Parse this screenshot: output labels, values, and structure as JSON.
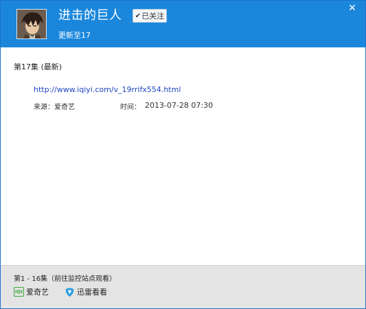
{
  "header": {
    "title": "进击的巨人",
    "follow_label": "已关注",
    "subtitle": "更新至17",
    "close_label": "✕"
  },
  "latest_episode": {
    "title": "第17集 (最新)",
    "url": "http://www.iqiyi.com/v_19rrifx554.html",
    "source_label": "来源：爱奇艺",
    "time_label": "时间：",
    "time_value": "2013-07-28 07:30"
  },
  "footer": {
    "label": "第1 - 16集（前往监控站点观看）",
    "sites": [
      {
        "name": "爱奇艺",
        "icon": "iqiyi-icon"
      },
      {
        "name": "迅雷看看",
        "icon": "xunlei-kankan-icon"
      }
    ]
  },
  "colors": {
    "header_bg": "#1b87dc",
    "link": "#1f46c4",
    "footer_bg": "#e4e4e4"
  }
}
